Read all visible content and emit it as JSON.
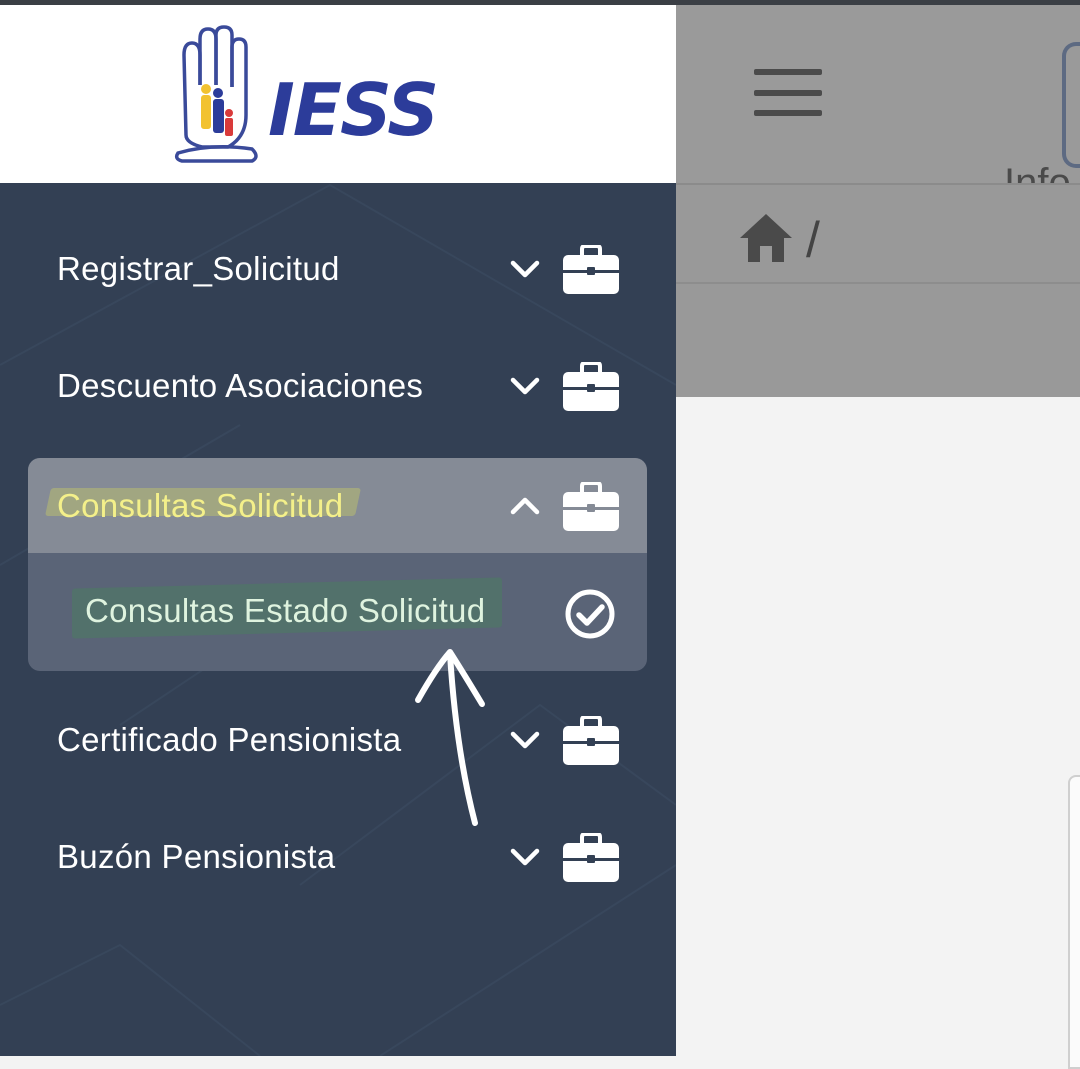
{
  "app": {
    "logo_text": "IESS"
  },
  "header": {
    "info_text_partial": "Info"
  },
  "breadcrumb": {
    "separator": "/"
  },
  "sidebar": {
    "items": [
      {
        "label": "Registrar_Solicitud",
        "icon": "briefcase-icon",
        "state": "collapsed"
      },
      {
        "label": "Descuento Asociaciones",
        "icon": "briefcase-icon",
        "state": "collapsed"
      },
      {
        "label": "Consultas Solicitud",
        "icon": "briefcase-icon",
        "state": "expanded",
        "children": [
          {
            "label": "Consultas Estado Solicitud",
            "icon": "check-circle-icon"
          }
        ]
      },
      {
        "label": "Certificado Pensionista",
        "icon": "briefcase-icon",
        "state": "collapsed"
      },
      {
        "label": "Buzón Pensionista",
        "icon": "briefcase-icon",
        "state": "collapsed"
      }
    ]
  },
  "colors": {
    "sidebar_bg": "#334054",
    "expanded_header_bg": "#858b96",
    "expanded_group_bg": "#5a6477",
    "brand_blue": "#2c3c9a",
    "highlight_yellow": "#f4f08a",
    "highlight_green": "#dff3df"
  }
}
